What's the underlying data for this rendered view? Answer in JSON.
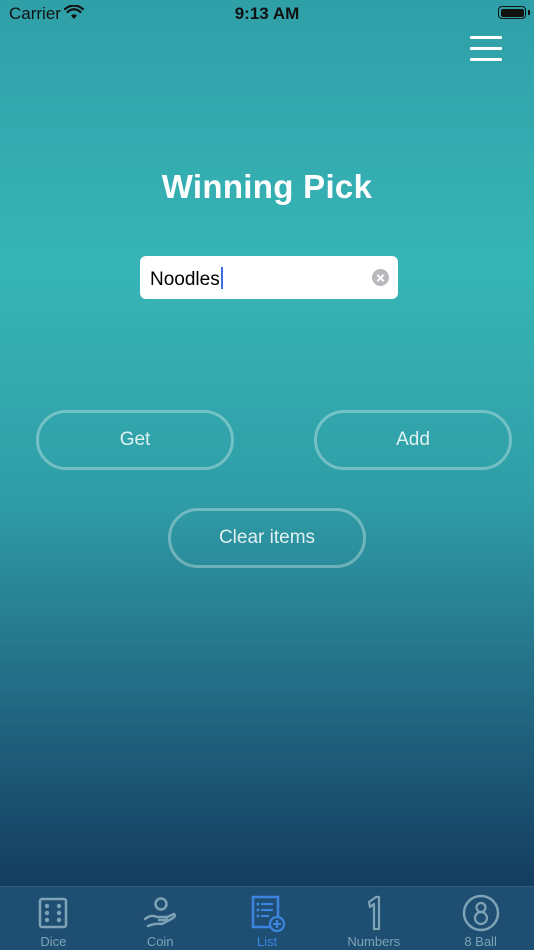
{
  "status_bar": {
    "carrier": "Carrier",
    "time": "9:13 AM"
  },
  "header": {
    "menu_icon": "hamburger-icon"
  },
  "main": {
    "title": "Winning Pick",
    "input": {
      "value": "Noodles",
      "clear_icon": "clear-circle-icon"
    },
    "buttons": {
      "get": "Get",
      "add": "Add",
      "clear": "Clear items"
    }
  },
  "tab_bar": {
    "active": "List",
    "tabs": [
      {
        "label": "Dice",
        "icon": "dice-icon"
      },
      {
        "label": "Coin",
        "icon": "coin-hand-icon"
      },
      {
        "label": "List",
        "icon": "list-add-icon"
      },
      {
        "label": "Numbers",
        "icon": "number-one-icon"
      },
      {
        "label": "8 Ball",
        "icon": "eight-ball-icon"
      }
    ]
  },
  "colors": {
    "accent": "#3d84e0",
    "inactive_tab": "#7fa3b6",
    "tab_bar_bg": "#1e4f72"
  }
}
